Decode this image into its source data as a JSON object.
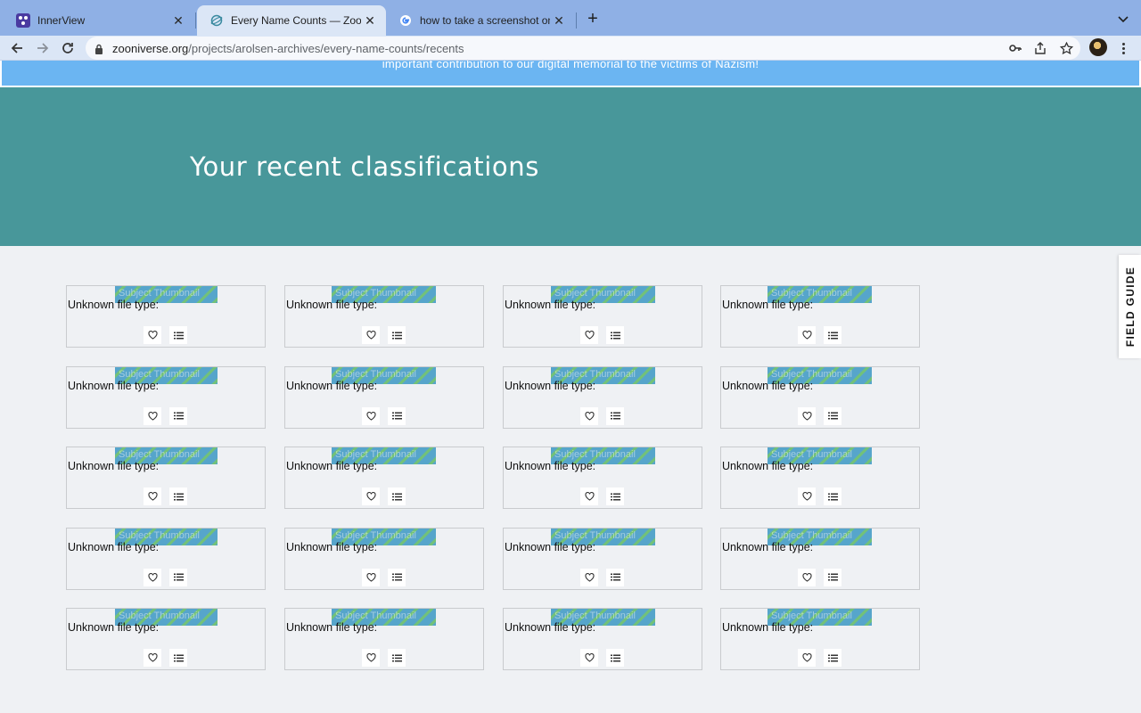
{
  "browser": {
    "tabs": [
      {
        "title": "InnerView",
        "favicon": "innerview-icon",
        "active": false
      },
      {
        "title": "Every Name Counts — Zooniverse",
        "favicon": "zooniverse-icon",
        "active": true
      },
      {
        "title": "how to take a screenshot on mac",
        "favicon": "google-icon",
        "active": false
      }
    ],
    "url_host": "zooniverse.org",
    "url_path": "/projects/arolsen-archives/every-name-counts/recents"
  },
  "banner": {
    "text": "important contribution to our digital memorial to the victims of Nazism!",
    "color": "#6bb5f2"
  },
  "hero": {
    "title": "Your recent classifications",
    "color": "#48979a"
  },
  "recents": {
    "rows": 5,
    "columns": 4,
    "item": {
      "alt_text": "Subject Thumbnail",
      "file_type_label": "Unknown file type:",
      "favorite_icon": "heart-icon",
      "collect_icon": "list-icon"
    }
  },
  "field_guide": {
    "label": "FIELD GUIDE"
  }
}
